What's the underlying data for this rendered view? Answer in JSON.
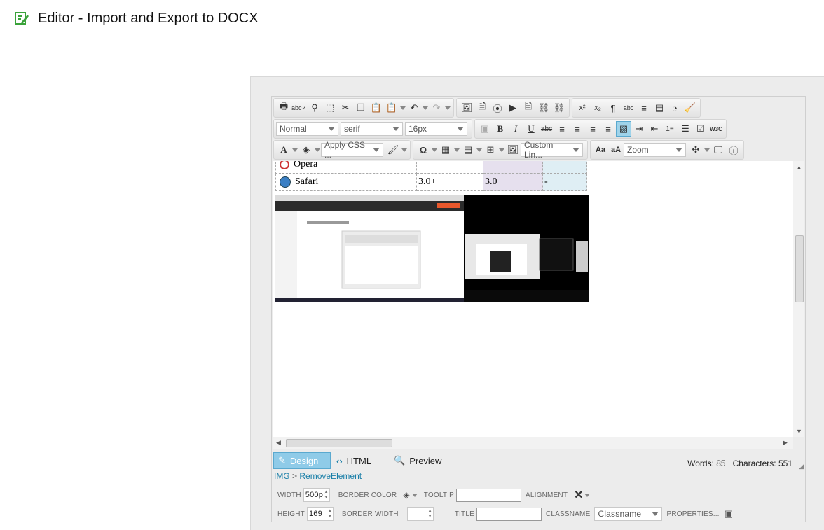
{
  "page": {
    "title": "Editor - Import and Export to DOCX",
    "title_icon": "edit-document-icon"
  },
  "toolbar": {
    "paragraph_format": "Normal",
    "font_name": "serif",
    "font_size": "16px",
    "apply_css": "Apply CSS ...",
    "custom_links": "Custom Lin...",
    "zoom": "Zoom",
    "bold": "B",
    "italic": "I",
    "underline": "U",
    "strike": "abc",
    "font_color": "A",
    "symbol": "Ω",
    "case_upper": "Aa",
    "case_lower": "aA",
    "superscript": "x²",
    "subscript": "x₂",
    "w3c": "W3C",
    "active_color": "#9fd3ea"
  },
  "content": {
    "table_rows": [
      {
        "browser": "Opera",
        "icon": "opera-icon",
        "v1": "",
        "v2": "",
        "v3": ""
      },
      {
        "browser": "Safari",
        "icon": "safari-icon",
        "v1": "3.0+",
        "v2": "3.0+",
        "v3": "-"
      }
    ],
    "cell_colors": {
      "purple": "#e6e0ee",
      "cyan": "#dfeef4"
    }
  },
  "bottom": {
    "modes": [
      {
        "label": "Design",
        "icon": "pencil-icon"
      },
      {
        "label": "HTML",
        "icon": "code-icon"
      },
      {
        "label": "Preview",
        "icon": "magnifier-icon"
      }
    ],
    "words_label": "Words: 85",
    "chars_label": "Characters: 551",
    "path_tag": "IMG",
    "path_action": "RemoveElement"
  },
  "properties": {
    "width_label": "WIDTH",
    "width_value": "500p:",
    "height_label": "HEIGHT",
    "height_value": "169",
    "border_color_label": "BORDER COLOR",
    "border_width_label": "BORDER WIDTH",
    "tooltip_label": "TOOLTIP",
    "title_label": "TITLE",
    "alignment_label": "ALIGNMENT",
    "classname_label": "CLASSNAME",
    "classname_placeholder": "Classname",
    "properties_label": "PROPERTIES..."
  }
}
